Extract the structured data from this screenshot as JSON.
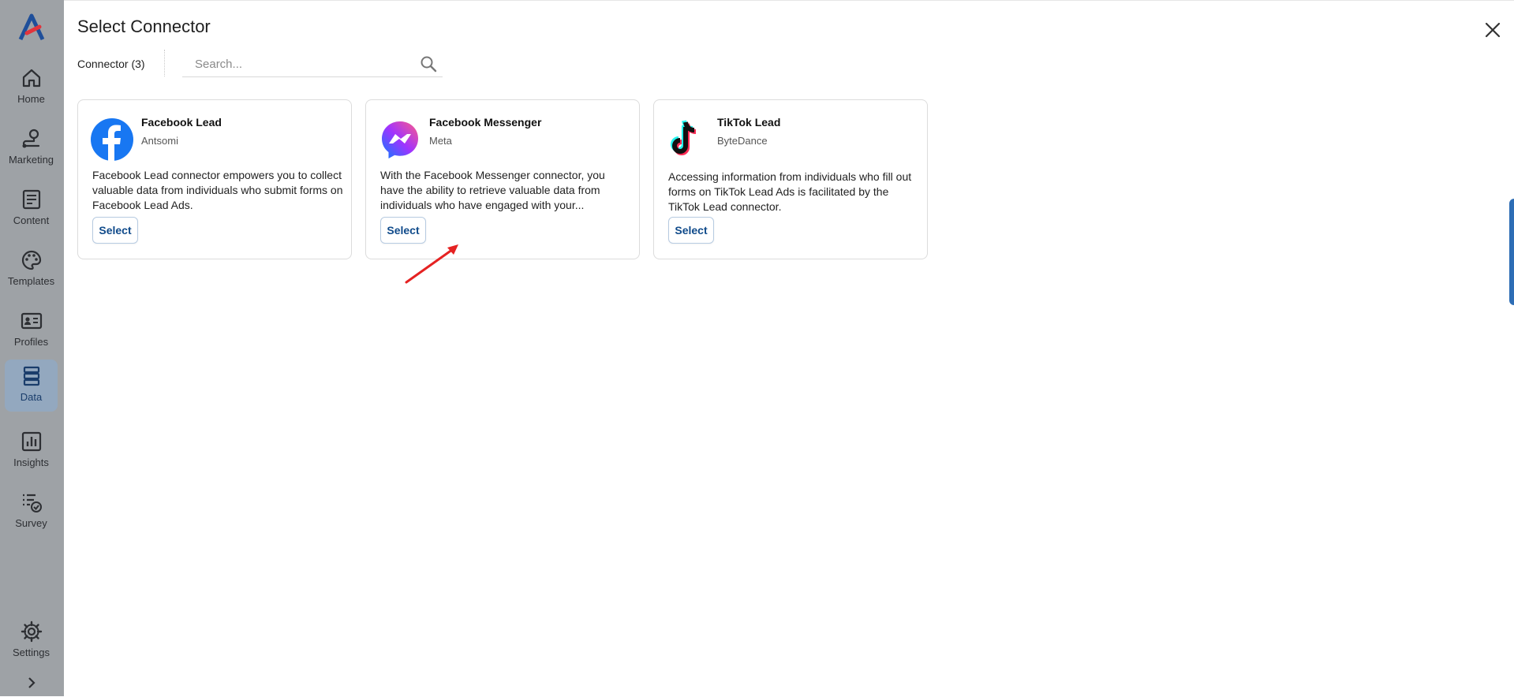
{
  "sidebar": {
    "items": [
      {
        "label": "Home",
        "icon": "home-icon"
      },
      {
        "label": "Marketing",
        "icon": "route-pin-icon"
      },
      {
        "label": "Content",
        "icon": "document-icon"
      },
      {
        "label": "Templates",
        "icon": "palette-icon"
      },
      {
        "label": "Profiles",
        "icon": "id-card-icon"
      },
      {
        "label": "Data",
        "icon": "database-icon",
        "active": true
      },
      {
        "label": "Insights",
        "icon": "bar-chart-icon"
      },
      {
        "label": "Survey",
        "icon": "checklist-icon"
      },
      {
        "label": "Settings",
        "icon": "gear-icon"
      }
    ]
  },
  "panel": {
    "title": "Select Connector",
    "connector_count": "Connector (3)",
    "search_placeholder": "Search..."
  },
  "cards": [
    {
      "name": "Facebook Lead",
      "vendor": "Antsomi",
      "description": "Facebook Lead connector empowers you to collect valuable data from individuals who submit forms on Facebook Lead Ads.",
      "button": "Select",
      "icon": "facebook-icon"
    },
    {
      "name": "Facebook Messenger",
      "vendor": "Meta",
      "description": "With the Facebook Messenger connector, you have the ability to retrieve valuable data from individuals who have engaged with your...",
      "button": "Select",
      "icon": "messenger-icon"
    },
    {
      "name": "TikTok Lead",
      "vendor": "ByteDance",
      "description": "Accessing information from individuals who fill out forms on TikTok Lead Ads is facilitated by the TikTok Lead connector.",
      "button": "Select",
      "icon": "tiktok-icon"
    }
  ],
  "colors": {
    "accent": "#0f4a8a",
    "sidebar_overlay": "#9ea2a6",
    "annotation_arrow": "#e52222"
  }
}
